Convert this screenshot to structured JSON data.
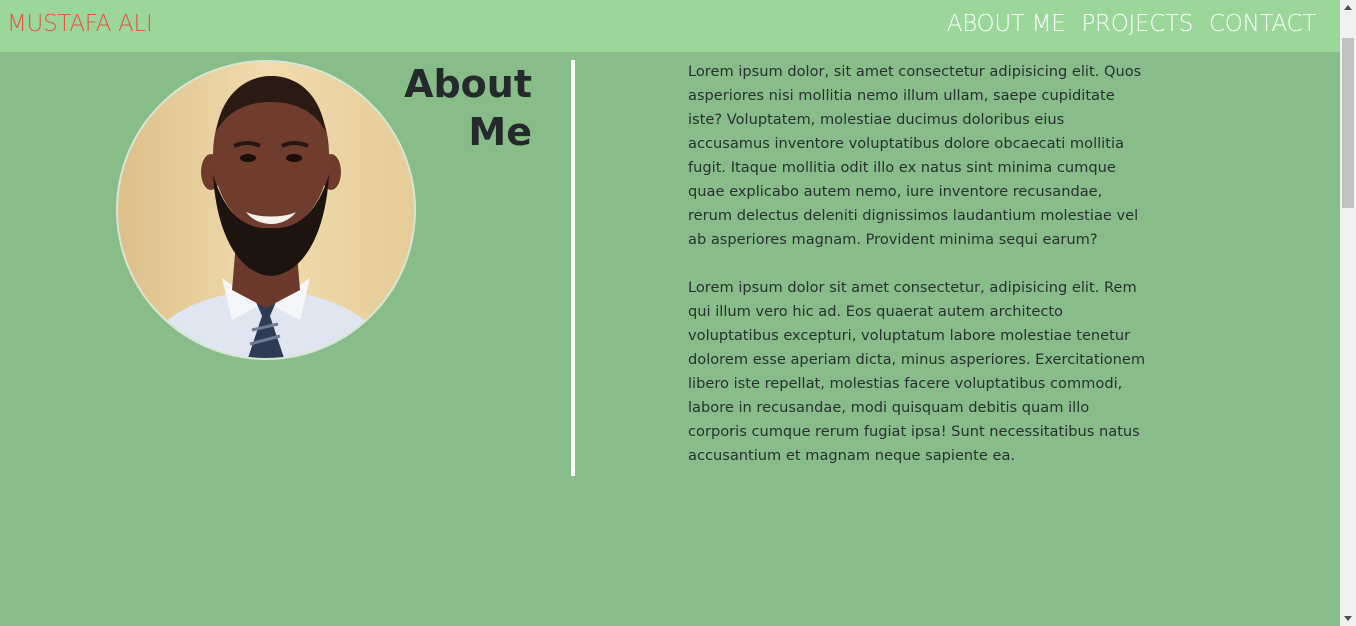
{
  "nav": {
    "brand": "MUSTAFA ALI",
    "links": [
      "ABOUT ME",
      "PROJECTS",
      "CONTACT"
    ]
  },
  "about": {
    "heading": "About Me",
    "paragraphs": [
      "Lorem ipsum dolor, sit amet consectetur adipisicing elit. Quos asperiores nisi mollitia nemo illum ullam, saepe cupiditate iste? Voluptatem, molestiae ducimus doloribus eius accusamus inventore voluptatibus dolore obcaecati mollitia fugit. Itaque mollitia odit illo ex natus sint minima cumque quae explicabo autem nemo, iure inventore recusandae, rerum delectus deleniti dignissimos laudantium molestiae vel ab asperiores magnam. Provident minima sequi earum?",
      "Lorem ipsum dolor sit amet consectetur, adipisicing elit. Rem qui illum vero hic ad. Eos quaerat autem architecto voluptatibus excepturi, voluptatum labore molestiae tenetur dolorem esse aperiam dicta, minus asperiores. Exercitationem libero iste repellat, molestias facere voluptatibus commodi, labore in recusandae, modi quisquam debitis quam illo corporis cumque rerum fugiat ipsa! Sunt necessitatibus natus accusantium et magnam neque sapiente ea."
    ]
  },
  "colors": {
    "navbar": "#9bd79b",
    "background": "#88bd8a",
    "brand": "#e8503c",
    "nav_text": "#ffffff",
    "divider": "#ffffff"
  }
}
